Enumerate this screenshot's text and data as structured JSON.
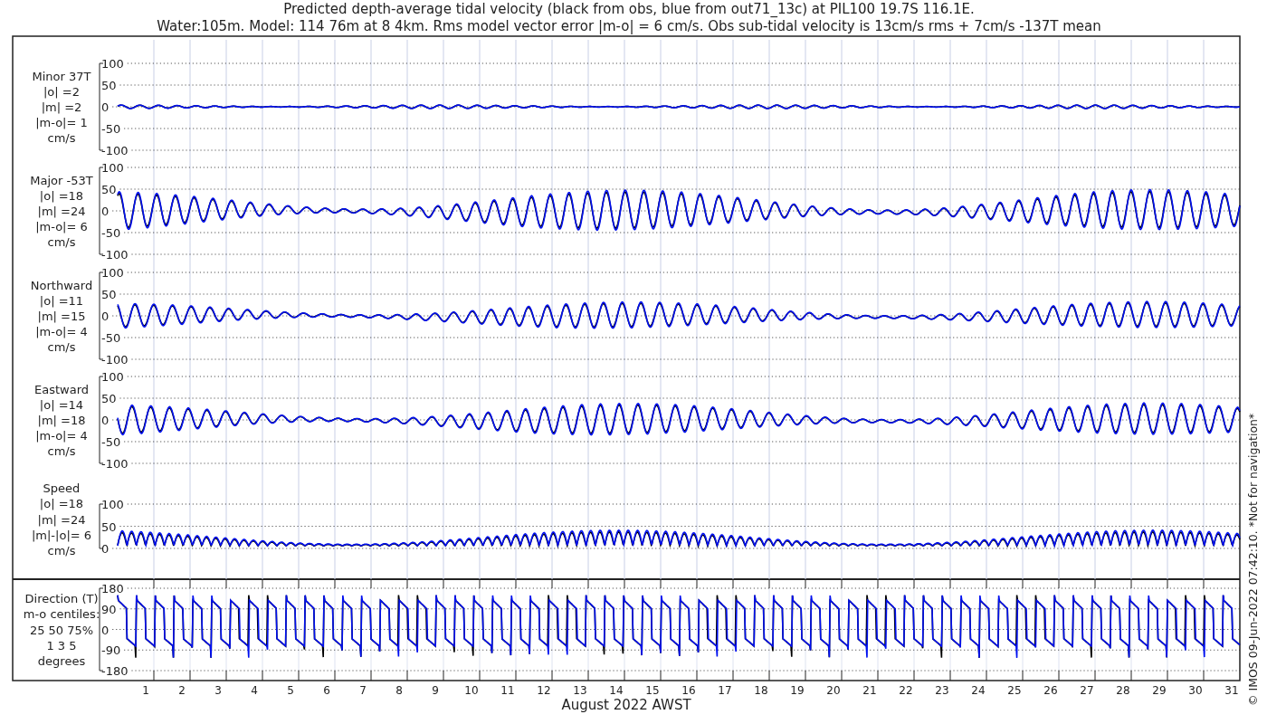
{
  "title_lines": [
    "Predicted depth-average tidal velocity (black from obs, blue from out71_13c) at PIL100 19.7S 116.1E.",
    "Water:105m. Model: 114 76m at 8 4km. Rms model vector error |m-o| = 6 cm/s. Obs sub-tidal velocity is 13cm/s rms + 7cm/s -137T mean"
  ],
  "panels": [
    {
      "kind": "flat",
      "label_lines": [
        "Minor 37T",
        "|o| =2",
        "|m| =2",
        "|m-o|= 1",
        "cm/s"
      ],
      "yticks": [
        "100",
        "50",
        "0",
        "-50",
        "-100"
      ]
    },
    {
      "kind": "tidal",
      "label_lines": [
        "Major -53T",
        "|o| =18",
        "|m| =24",
        "|m-o|= 6",
        "cm/s"
      ],
      "yticks": [
        "100",
        "50",
        "0",
        "-50",
        "-100"
      ]
    },
    {
      "kind": "tidal",
      "label_lines": [
        "Northward",
        "|o| =11",
        "|m| =15",
        "|m-o|= 4",
        "cm/s"
      ],
      "yticks": [
        "100",
        "50",
        "0",
        "-50",
        "-100"
      ]
    },
    {
      "kind": "tidal",
      "label_lines": [
        "Eastward",
        "|o| =14",
        "|m| =18",
        "|m-o|= 4",
        "cm/s"
      ],
      "yticks": [
        "100",
        "50",
        "0",
        "-50",
        "-100"
      ]
    },
    {
      "kind": "speed",
      "label_lines": [
        "Speed",
        "|o| =18",
        "|m| =24",
        "|m|-|o|= 6",
        "cm/s"
      ],
      "yticks": [
        "100",
        "50",
        "0"
      ]
    },
    {
      "kind": "direction",
      "label_lines": [
        "Direction (T)",
        "m-o centiles:",
        "25  50  75%",
        "1  3  5",
        "degrees"
      ],
      "yticks": [
        "180",
        "90",
        "0",
        "-90",
        "-180"
      ]
    }
  ],
  "xticks": [
    "1",
    "2",
    "3",
    "4",
    "5",
    "6",
    "7",
    "8",
    "9",
    "10",
    "11",
    "12",
    "13",
    "14",
    "15",
    "16",
    "17",
    "18",
    "19",
    "20",
    "21",
    "22",
    "23",
    "24",
    "25",
    "26",
    "27",
    "28",
    "29",
    "30",
    "31"
  ],
  "xlabel": "August 2022 AWST",
  "side_note": "© IMOS 09-Jun-2022 07:42:10. *Not for navigation*"
}
